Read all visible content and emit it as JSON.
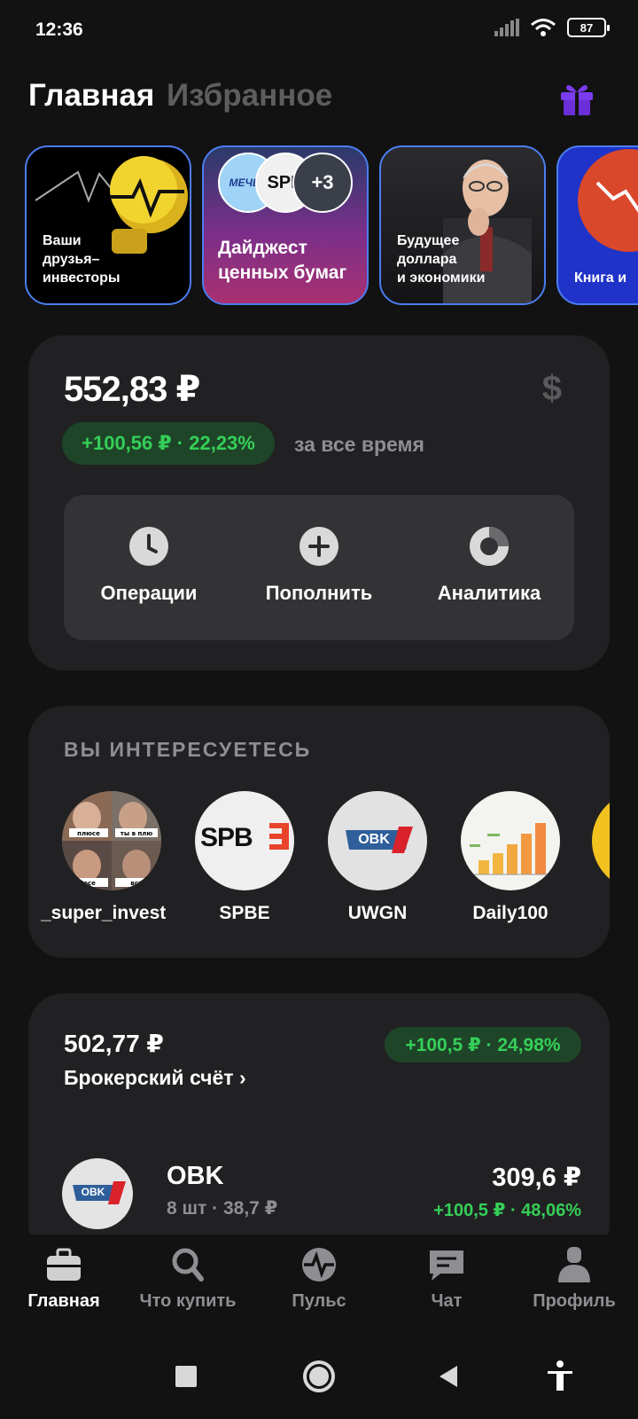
{
  "status": {
    "time": "12:36",
    "battery": "87"
  },
  "header": {
    "tab_main": "Главная",
    "tab_favorites": "Избранное"
  },
  "stories": [
    {
      "label": "Ваши\nдрузья–\nинвесторы"
    },
    {
      "label": "Дайджест\nценных бумаг",
      "badge_1": "МЕЧЕЛ",
      "badge_2": "SPB",
      "badge_more": "+3"
    },
    {
      "label": "Будущее\nдоллара\nи экономики"
    },
    {
      "label": "Книга и"
    }
  ],
  "portfolio": {
    "total": "552,83 ₽",
    "currency_symbol": "$",
    "change": "+100,56 ₽ · 22,23%",
    "period": "за все время",
    "actions": [
      {
        "label": "Операции"
      },
      {
        "label": "Пополнить"
      },
      {
        "label": "Аналитика"
      }
    ]
  },
  "interests": {
    "title": "ВЫ ИНТЕРЕСУЕТЕСЬ",
    "items": [
      {
        "label": "_super_invest",
        "meme_1": "плюсе",
        "meme_2": "ты в плю",
        "meme_3": "юсе",
        "meme_4": "всп"
      },
      {
        "label": "SPBE",
        "logo_text": "SPB"
      },
      {
        "label": "UWGN",
        "logo_text": "OBK"
      },
      {
        "label": "Daily100"
      }
    ]
  },
  "account": {
    "value": "502,77 ₽",
    "name": "Брокерский счёт ›",
    "change": "+100,5 ₽ · 24,98%",
    "position": {
      "name": "OBK",
      "logo_text": "OBK",
      "sub": "8 шт · 38,7 ₽",
      "price": "309,6 ₽",
      "change": "+100,5 ₽ · 48,06%"
    }
  },
  "nav": [
    {
      "label": "Главная"
    },
    {
      "label": "Что купить"
    },
    {
      "label": "Пульс"
    },
    {
      "label": "Чат"
    },
    {
      "label": "Профиль"
    }
  ],
  "colors": {
    "background": "#121212",
    "card": "#212123",
    "accent_green": "#35cf58",
    "story_border": "#4b7df0",
    "gift": "#7b3cf0"
  }
}
